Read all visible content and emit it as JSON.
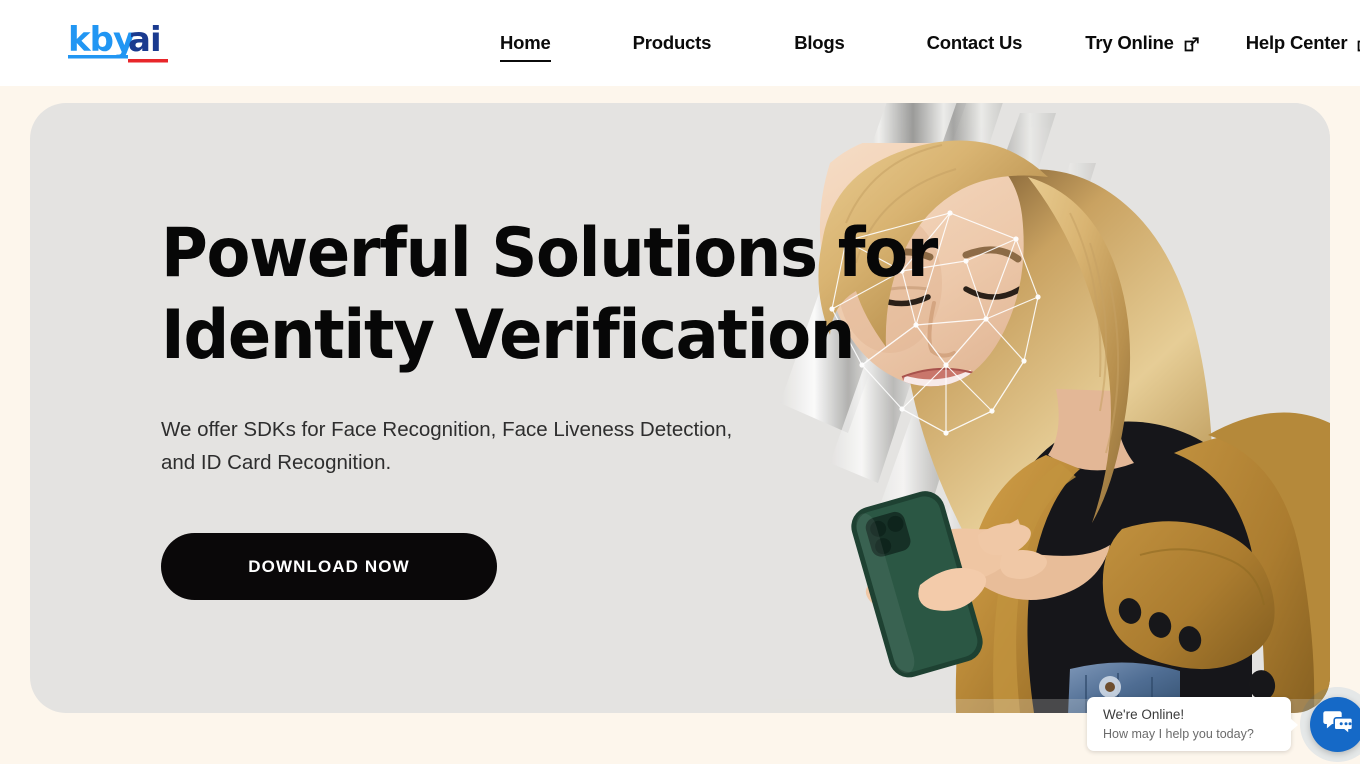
{
  "brand": {
    "logo_text_primary": "kby",
    "logo_text_secondary": "ai",
    "logo_color_primary": "#2196f3",
    "logo_color_secondary": "#1a3a8f",
    "underline_color_primary": "#2196f3",
    "underline_color_secondary": "#e8262a"
  },
  "nav": {
    "items": [
      {
        "label": "Home",
        "active": true,
        "external": false
      },
      {
        "label": "Products",
        "active": false,
        "external": false
      },
      {
        "label": "Blogs",
        "active": false,
        "external": false
      },
      {
        "label": "Contact Us",
        "active": false,
        "external": false
      },
      {
        "label": "Try Online",
        "active": false,
        "external": true
      },
      {
        "label": "Help Center",
        "active": false,
        "external": true
      }
    ]
  },
  "hero": {
    "title_line1": "Powerful Solutions for",
    "title_line2": "Identity Verification",
    "subtitle": "We offer SDKs for Face Recognition, Face Liveness Detection, and ID Card Recognition.",
    "cta_label": "DOWNLOAD NOW",
    "card_background": "#e4e3e1",
    "cta_background": "#0a0809",
    "cta_text_color": "#ffffff",
    "image_alt": "Woman in mustard coat holding a green smartphone with a facial-recognition landmark mesh overlaid on her face"
  },
  "chat": {
    "status_text": "We're Online!",
    "prompt_text": "How may I help you today?",
    "button_color": "#1569c7",
    "icon": "chat-bubbles-icon"
  },
  "page": {
    "background_top": "#ffffff",
    "background_bottom": "#fdf6ec"
  }
}
